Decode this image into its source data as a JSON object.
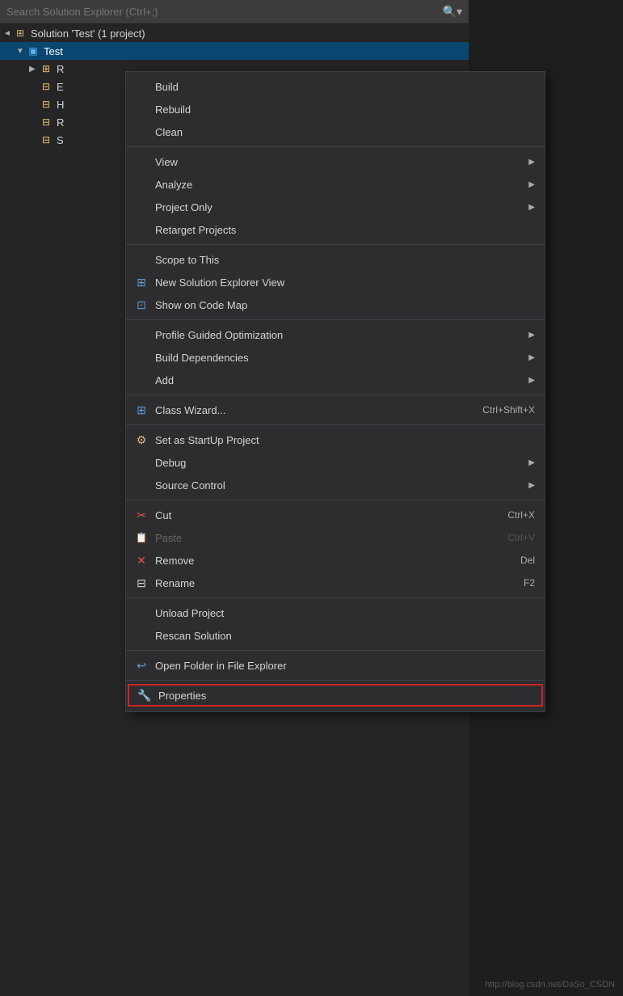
{
  "searchBar": {
    "placeholder": "Search Solution Explorer (Ctrl+;)"
  },
  "solutionTree": {
    "solutionLabel": "Solution 'Test' (1 project)",
    "projectLabel": "Test",
    "items": [
      {
        "label": "R..."
      },
      {
        "label": "E..."
      },
      {
        "label": "H..."
      },
      {
        "label": "R..."
      },
      {
        "label": "S..."
      }
    ]
  },
  "contextMenu": {
    "items": [
      {
        "id": "build",
        "icon": "",
        "label": "Build",
        "shortcut": "",
        "hasArrow": false,
        "disabled": false
      },
      {
        "id": "rebuild",
        "icon": "",
        "label": "Rebuild",
        "shortcut": "",
        "hasArrow": false,
        "disabled": false
      },
      {
        "id": "clean",
        "icon": "",
        "label": "Clean",
        "shortcut": "",
        "hasArrow": false,
        "disabled": false
      },
      {
        "id": "sep1",
        "type": "separator"
      },
      {
        "id": "view",
        "icon": "",
        "label": "View",
        "shortcut": "",
        "hasArrow": true,
        "disabled": false
      },
      {
        "id": "analyze",
        "icon": "",
        "label": "Analyze",
        "shortcut": "",
        "hasArrow": true,
        "disabled": false
      },
      {
        "id": "projectonly",
        "icon": "",
        "label": "Project Only",
        "shortcut": "",
        "hasArrow": true,
        "disabled": false
      },
      {
        "id": "retarget",
        "icon": "",
        "label": "Retarget Projects",
        "shortcut": "",
        "hasArrow": false,
        "disabled": false
      },
      {
        "id": "sep2",
        "type": "separator"
      },
      {
        "id": "scopetothis",
        "icon": "",
        "label": "Scope to This",
        "shortcut": "",
        "hasArrow": false,
        "disabled": false
      },
      {
        "id": "newsolutionview",
        "icon": "newsol",
        "label": "New Solution Explorer View",
        "shortcut": "",
        "hasArrow": false,
        "disabled": false
      },
      {
        "id": "showcodemap",
        "icon": "codemap",
        "label": "Show on Code Map",
        "shortcut": "",
        "hasArrow": false,
        "disabled": false
      },
      {
        "id": "sep3",
        "type": "separator"
      },
      {
        "id": "profileguided",
        "icon": "",
        "label": "Profile Guided Optimization",
        "shortcut": "",
        "hasArrow": true,
        "disabled": false
      },
      {
        "id": "builddeps",
        "icon": "",
        "label": "Build Dependencies",
        "shortcut": "",
        "hasArrow": true,
        "disabled": false
      },
      {
        "id": "add",
        "icon": "",
        "label": "Add",
        "shortcut": "",
        "hasArrow": true,
        "disabled": false
      },
      {
        "id": "sep4",
        "type": "separator"
      },
      {
        "id": "classwizard",
        "icon": "class",
        "label": "Class Wizard...",
        "shortcut": "Ctrl+Shift+X",
        "hasArrow": false,
        "disabled": false
      },
      {
        "id": "sep5",
        "type": "separator"
      },
      {
        "id": "setstartup",
        "icon": "startup",
        "label": "Set as StartUp Project",
        "shortcut": "",
        "hasArrow": false,
        "disabled": false
      },
      {
        "id": "debug",
        "icon": "",
        "label": "Debug",
        "shortcut": "",
        "hasArrow": true,
        "disabled": false
      },
      {
        "id": "sourcecontrol",
        "icon": "",
        "label": "Source Control",
        "shortcut": "",
        "hasArrow": true,
        "disabled": false
      },
      {
        "id": "sep6",
        "type": "separator"
      },
      {
        "id": "cut",
        "icon": "cut",
        "label": "Cut",
        "shortcut": "Ctrl+X",
        "hasArrow": false,
        "disabled": false
      },
      {
        "id": "paste",
        "icon": "paste",
        "label": "Paste",
        "shortcut": "Ctrl+V",
        "hasArrow": false,
        "disabled": true
      },
      {
        "id": "remove",
        "icon": "remove",
        "label": "Remove",
        "shortcut": "Del",
        "hasArrow": false,
        "disabled": false
      },
      {
        "id": "rename",
        "icon": "rename",
        "label": "Rename",
        "shortcut": "F2",
        "hasArrow": false,
        "disabled": false
      },
      {
        "id": "sep7",
        "type": "separator"
      },
      {
        "id": "unload",
        "icon": "",
        "label": "Unload Project",
        "shortcut": "",
        "hasArrow": false,
        "disabled": false
      },
      {
        "id": "rescan",
        "icon": "",
        "label": "Rescan Solution",
        "shortcut": "",
        "hasArrow": false,
        "disabled": false
      },
      {
        "id": "sep8",
        "type": "separator"
      },
      {
        "id": "openfolder",
        "icon": "folder",
        "label": "Open Folder in File Explorer",
        "shortcut": "",
        "hasArrow": false,
        "disabled": false
      },
      {
        "id": "sep9",
        "type": "separator"
      },
      {
        "id": "properties",
        "icon": "wrench",
        "label": "Properties",
        "shortcut": "",
        "hasArrow": false,
        "disabled": false,
        "highlighted": true
      }
    ]
  },
  "watermark": "http://blog.csdn.net/DaSo_CSDN"
}
